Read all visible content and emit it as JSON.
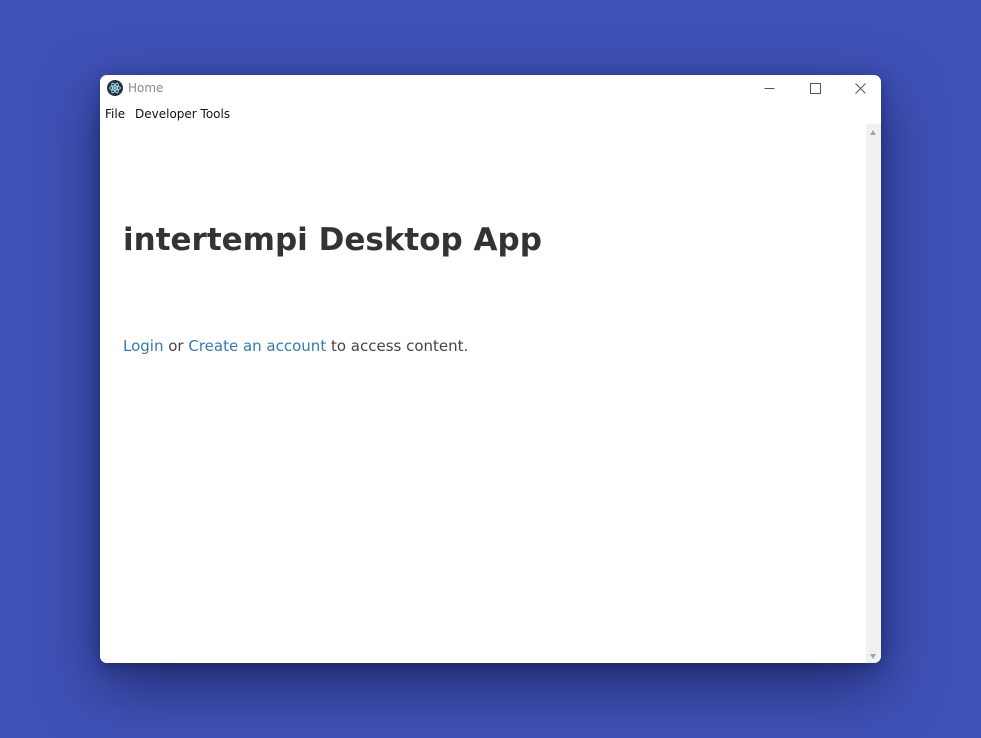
{
  "window": {
    "title": "Home",
    "app_icon": "electron-icon",
    "controls": {
      "minimize_icon": "minimize-icon",
      "maximize_icon": "maximize-icon",
      "close_icon": "close-icon"
    }
  },
  "menu": {
    "items": [
      {
        "label": "File"
      },
      {
        "label": "Developer Tools"
      }
    ]
  },
  "page": {
    "heading": "intertempi Desktop App",
    "login_link": "Login",
    "or_text": " or ",
    "create_account_link": "Create an account",
    "suffix_text": " to access content."
  },
  "colors": {
    "desktop_background": "#3f51b5",
    "link": "#337ab7",
    "heading_text": "#333333"
  }
}
